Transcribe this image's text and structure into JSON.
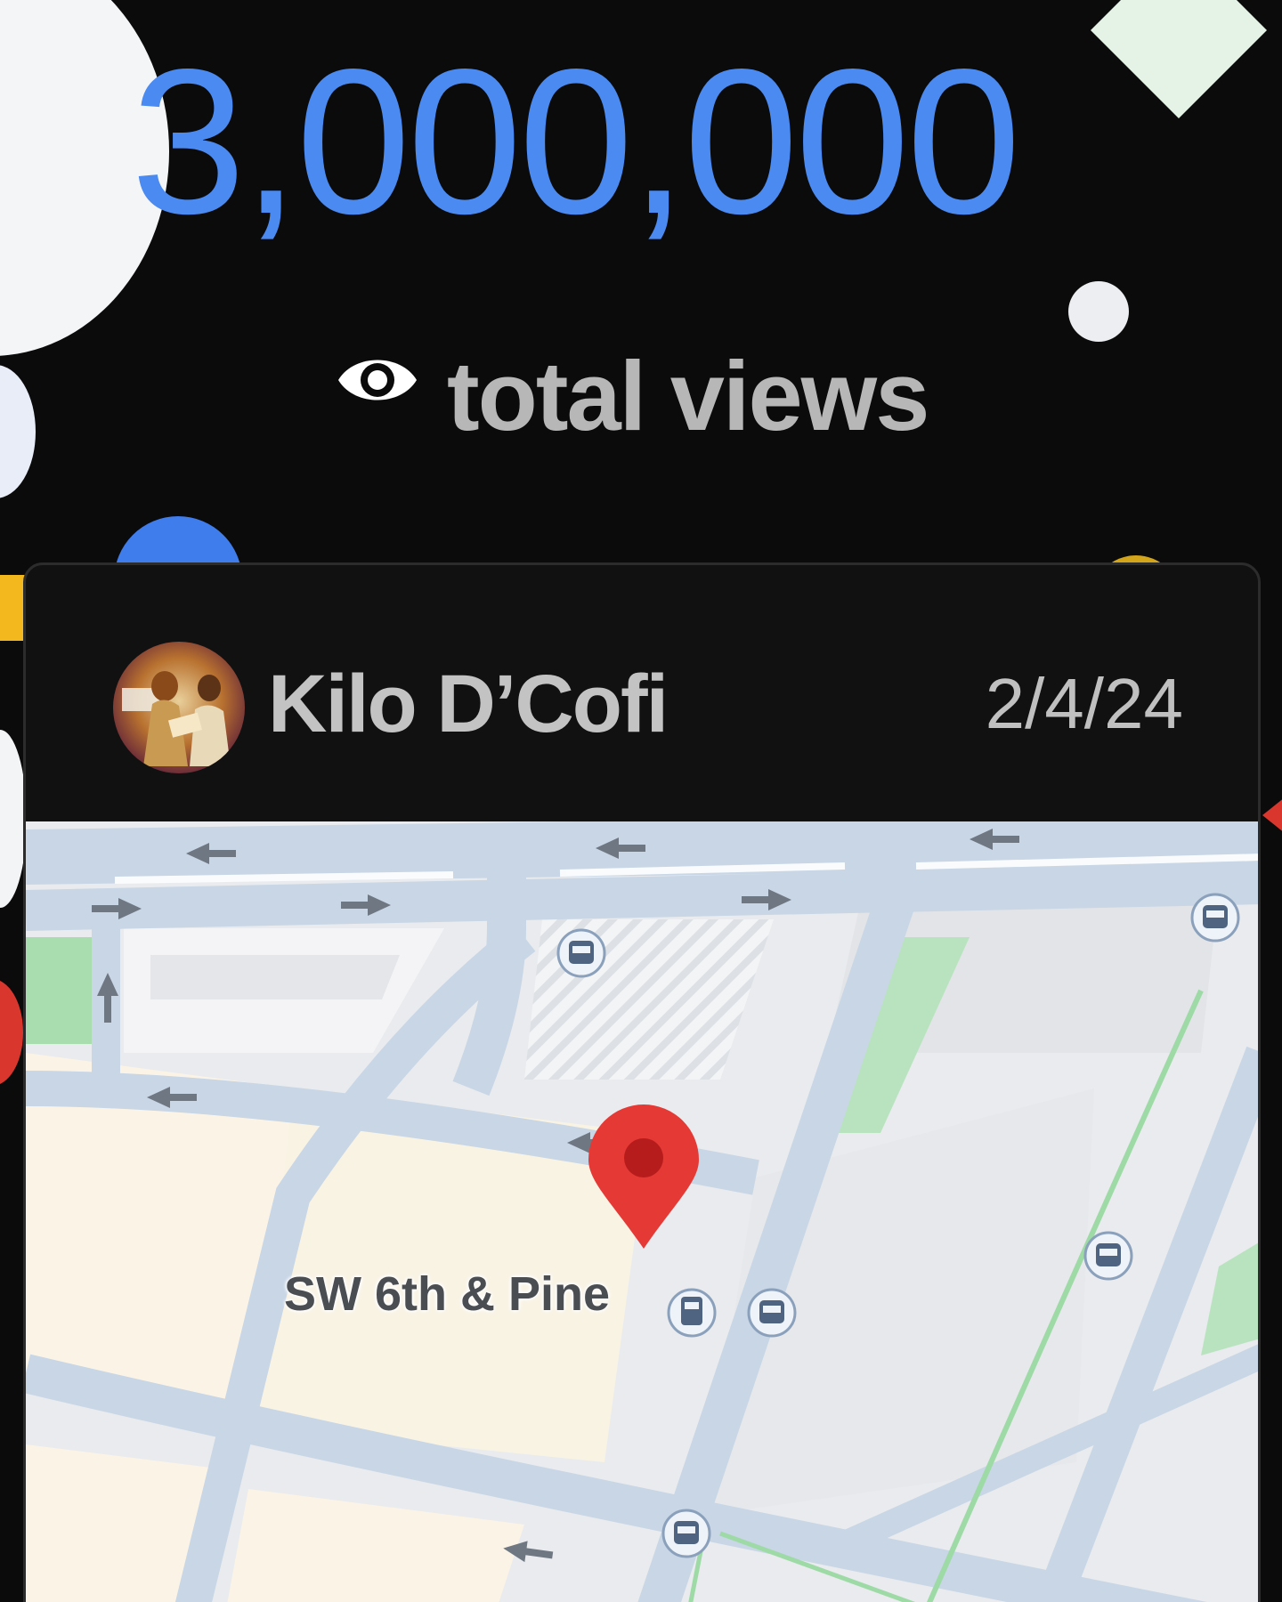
{
  "stats": {
    "count": "3,000,000",
    "label": "total views",
    "accent_color": "#4b8af0",
    "icon": "eye-icon"
  },
  "post": {
    "author": "Kilo D’Cofi",
    "date": "2/4/24",
    "avatar_icon": "avatar-photo"
  },
  "map": {
    "place_label": "SW 6th & Pine",
    "pin_color": "#e53935",
    "marker_icon": "location-pin-icon",
    "transit_icon": "bus-stop-icon"
  }
}
